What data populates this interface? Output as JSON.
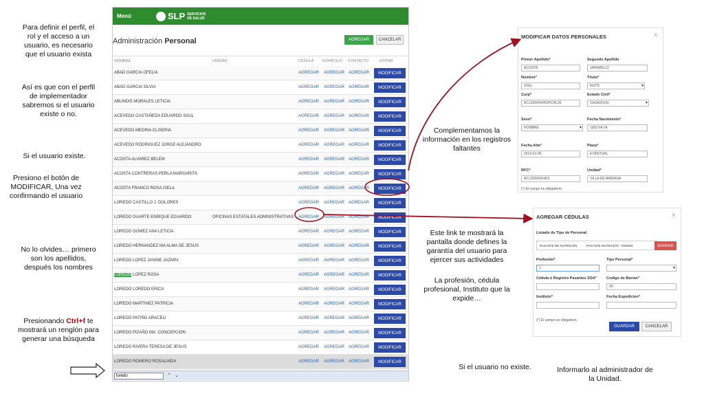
{
  "annotations": {
    "a1": "Para definir el perfil, el rol y el acceso a un usuario, es necesario que el usuario exista",
    "a2": "Así es que con el perfil de implementador sabremos si el usuario existe o no.",
    "a3": "Si el usuario existe.",
    "a4": "Presiono el botón de MODIFICAR, Una vez confirmando el usuario",
    "a5": "No lo olvides… primero son los apellidos, después los nombres",
    "a6_pre": "Presionando ",
    "a6_key": "Ctrl+f",
    "a6_post": " te mostrará un renglón para generar una búsqueda",
    "a7": "Complementamos la información en los registros faltantes",
    "a8": "Este link te mostrará la pantalla donde defines la garantía del usuario para ejercer sus actividades",
    "a9": "La profesión, cédula profesional, Instituto que la expide…",
    "a10": "Si el usuario no existe.",
    "a11": "Informarlo al administrador de la Unidad."
  },
  "app": {
    "menu_label": "Menú",
    "logo_text": "SLP",
    "logo_sub1": "SERVICIOS",
    "logo_sub2": "DE SALUD",
    "page_title_prefix": "Administración ",
    "page_title_bold": "Personal",
    "btn_agregar": "AGREGAR",
    "btn_cancelar": "CANCELAR",
    "columns": [
      "NOMBRE",
      "UNIDAD",
      "CÉDULA",
      "DOMICILIO",
      "CONTACTO",
      "EDITAR"
    ],
    "link_label": "AGREGAR",
    "modify_label": "MODIFICAR",
    "rows": [
      {
        "name": "ABAD GARCIA OFELIA",
        "unit": ""
      },
      {
        "name": "ABAD GARCIA SILVIA",
        "unit": ""
      },
      {
        "name": "ABUNDIS MORALES LETICIA",
        "unit": ""
      },
      {
        "name": "ACEVEDO CASTAÑEDA EDUARDO SAUL",
        "unit": ""
      },
      {
        "name": "ACEVEDO MEDINA CLISERIA",
        "unit": ""
      },
      {
        "name": "ACEVEDO RODRIGUEZ JORGE ALEJANDRO",
        "unit": ""
      },
      {
        "name": "ACOSTA ALVAREZ BELEM",
        "unit": ""
      },
      {
        "name": "ACOSTA CONTRERAS PERLA MARGARITA",
        "unit": ""
      },
      {
        "name": "ACOSTA FRANCO ROSA ISELA",
        "unit": ""
      },
      {
        "name": "LOREDO CASTILLO J. DOLORES",
        "unit": ""
      },
      {
        "name": "LOREDO DUARTE ENRIQUE EDUARDO",
        "unit": "OFICINAS ESTATALES ADMINISTRATIVAS"
      },
      {
        "name": "LOREDO GOMEZ ANA LETICIA",
        "unit": ""
      },
      {
        "name": "LOREDO HERNANDEZ MA ALMA DE JESUS",
        "unit": ""
      },
      {
        "name": "LOREDO LOPEZ JANINE JAZMIN",
        "unit": ""
      },
      {
        "name": "LOPEZ ROSA",
        "unit": "",
        "hl": "LOREDO"
      },
      {
        "name": "LOREDO LOREDO ERICA",
        "unit": ""
      },
      {
        "name": "LOREDO MARTINEZ PATRICIA",
        "unit": ""
      },
      {
        "name": "LOREDO PATIÑO ARACELI",
        "unit": ""
      },
      {
        "name": "LOREDO PIZAÑO MA. CONCEPCION",
        "unit": ""
      },
      {
        "name": "LOREDO RIVERA TERESA DE JESUS",
        "unit": ""
      },
      {
        "name": "LOREDO ROMERO ROSALINDA",
        "unit": ""
      }
    ],
    "find_value": "loredo"
  },
  "modal1": {
    "title": "MODIFICAR DATOS PERSONALES",
    "close": "x",
    "labels": {
      "primer_apellido": "Primer Apellido",
      "segundo_apellido": "Segundo Apellido",
      "nombre": "Nombre",
      "titulo": "Título",
      "curp": "Curp",
      "estado_civil": "Estado Civil",
      "sexo": "Sexo",
      "fecha_nacimiento": "Fecha Nacimiento",
      "fecha_alta": "Fecha Alta",
      "plaza": "Plaza",
      "rfc": "RFC",
      "unidad": "Unidad"
    },
    "values": {
      "primer_apellido": "ACOSTA",
      "segundo_apellido": "JARAMILLO",
      "nombre": "JOEL",
      "titulo": "NUTR.",
      "curp": "ACJJ920424HSPCRL06",
      "estado_civil": "CASADO(A)",
      "sexo": "HOMBRE",
      "fecha_nacimiento": "1992-04-24",
      "fecha_alta": "2014-01-06",
      "plaza": "EVENTUAL",
      "rfc": "ACJJ920424JK5",
      "unidad": "VILLA DE ARRIAGA"
    },
    "note": "(*) El campo es obligatorio."
  },
  "modal2": {
    "title": "AGREGAR CÉDULAS",
    "close": "x",
    "list_label": "Listado de Tipo de Personal",
    "list_cells": [
      "PASANTE DE NUTRICIÓN",
      "PASANTE NUTRICIÓN",
      "7000004"
    ],
    "btn_borrar": "BORRAR",
    "labels": {
      "profesion": "Profesión",
      "tipo_personal": "Tipo Personal",
      "cedula": "Cédula ó Registro Pasantes SSA",
      "codigo": "Codigo de Barras",
      "instituto": "Instituto",
      "fecha_exp": "Fecha Expedicion"
    },
    "values": {
      "profesion": "1",
      "tipo_personal": "",
      "cedula": "",
      "codigo": "00",
      "instituto": "",
      "fecha_exp": ""
    },
    "note": "(*) El campo es obligatorio.",
    "btn_guardar": "GUARDAR",
    "btn_cancelar": "CANCELAR"
  },
  "colors": {
    "green_bar": "#2e8b2e",
    "modify_blue": "#2b4aa8",
    "link_blue": "#2b5fa8",
    "annotation_red": "#a01020"
  }
}
